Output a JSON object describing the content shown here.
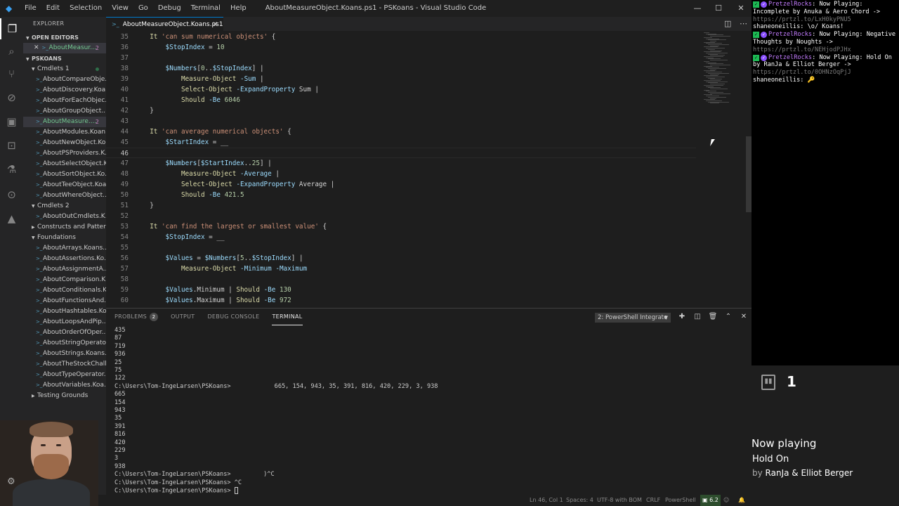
{
  "window": {
    "title": "AboutMeasureObject.Koans.ps1 - PSKoans - Visual Studio Code",
    "menu": [
      "File",
      "Edit",
      "Selection",
      "View",
      "Go",
      "Debug",
      "Terminal",
      "Help"
    ]
  },
  "sidebar": {
    "title": "EXPLORER",
    "open_editors": "OPEN EDITORS",
    "open_file": "AboutMeasur...",
    "open_file_badge": "2",
    "project": "PSKOANS",
    "folders": {
      "cmdlets1": "Cmdlets 1",
      "cmdlets2": "Cmdlets 2",
      "constructs": "Constructs and Patter...",
      "foundations": "Foundations",
      "testing": "Testing Grounds"
    },
    "cmdlets1_files": [
      "AboutCompareObje...",
      "AboutDiscovery.Koa...",
      "AboutForEachObjec...",
      "AboutGroupObject....",
      "AboutMeasure....",
      "AboutModules.Koan...",
      "AboutNewObject.Ko...",
      "AboutPSProviders.K...",
      "AboutSelectObject.K...",
      "AboutSortObject.Ko...",
      "AboutTeeObject.Koa...",
      "AboutWhereObject...."
    ],
    "selected_badge": "2",
    "cmdlets2_files": [
      "AboutOutCmdlets.K..."
    ],
    "foundations_files": [
      "AboutArrays.Koans....",
      "AboutAssertions.Ko...",
      "AboutAssignmentA...",
      "AboutComparison.K...",
      "AboutConditionals.K...",
      "AboutFunctionsAnd...",
      "AboutHashtables.Ko...",
      "AboutLoopsAndPip...",
      "AboutOrderOfOper...",
      "AboutStringOperato...",
      "AboutStrings.Koans....",
      "AboutTheStockChall...",
      "AboutTypeOperator....",
      "AboutVariables.Koa..."
    ]
  },
  "tab": {
    "label": "AboutMeasureObject.Koans.ps1"
  },
  "editor": {
    "lines": [
      {
        "n": "35",
        "t": "  It 'can sum numerical objects' {"
      },
      {
        "n": "36",
        "t": "      $StopIndex = 10"
      },
      {
        "n": "37",
        "t": ""
      },
      {
        "n": "38",
        "t": "      $Numbers[0..$StopIndex] |"
      },
      {
        "n": "39",
        "t": "          Measure-Object -Sum |"
      },
      {
        "n": "40",
        "t": "          Select-Object -ExpandProperty Sum |"
      },
      {
        "n": "41",
        "t": "          Should -Be 6046"
      },
      {
        "n": "42",
        "t": "  }"
      },
      {
        "n": "43",
        "t": ""
      },
      {
        "n": "44",
        "t": "  It 'can average numerical objects' {"
      },
      {
        "n": "45",
        "t": "      $StartIndex = __"
      },
      {
        "n": "46",
        "t": ""
      },
      {
        "n": "47",
        "t": "      $Numbers[$StartIndex..25] |"
      },
      {
        "n": "48",
        "t": "          Measure-Object -Average |"
      },
      {
        "n": "49",
        "t": "          Select-Object -ExpandProperty Average |"
      },
      {
        "n": "50",
        "t": "          Should -Be 421.5"
      },
      {
        "n": "51",
        "t": "  }"
      },
      {
        "n": "52",
        "t": ""
      },
      {
        "n": "53",
        "t": "  It 'can find the largest or smallest value' {"
      },
      {
        "n": "54",
        "t": "      $StopIndex = __"
      },
      {
        "n": "55",
        "t": ""
      },
      {
        "n": "56",
        "t": "      $Values = $Numbers[5..$StopIndex] |"
      },
      {
        "n": "57",
        "t": "          Measure-Object -Minimum -Maximum"
      },
      {
        "n": "58",
        "t": ""
      },
      {
        "n": "59",
        "t": "      $Values.Minimum | Should -Be 130"
      },
      {
        "n": "60",
        "t": "      $Values.Maximum | Should -Be 972"
      }
    ]
  },
  "panel": {
    "tabs": {
      "problems": "PROBLEMS",
      "output": "OUTPUT",
      "debug": "DEBUG CONSOLE",
      "terminal": "TERMINAL"
    },
    "problems_count": "2",
    "terminal_select": "2: PowerShell Integrate",
    "terminal_lines": [
      "435",
      "87",
      "719",
      "936",
      "25",
      "75",
      "122",
      "C:\\Users\\Tom-IngeLarsen\\PSKoans>            665, 154, 943, 35, 391, 816, 420, 229, 3, 938",
      "665",
      "154",
      "943",
      "35",
      "391",
      "816",
      "420",
      "229",
      "3",
      "938",
      "C:\\Users\\Tom-IngeLarsen\\PSKoans>         )^C",
      "C:\\Users\\Tom-IngeLarsen\\PSKoans> ^C",
      "C:\\Users\\Tom-IngeLarsen\\PSKoans> "
    ]
  },
  "statusbar": {
    "position": "Ln 46, Col 1",
    "spaces": "Spaces: 4",
    "encoding": "UTF-8 with BOM",
    "eol": "CRLF",
    "language": "PowerShell",
    "version": "6.2"
  },
  "chat": {
    "messages": [
      {
        "user": "PretzelRocks",
        "text": ": Now Playing: Incomplete by Anuka & Aero Chord ->",
        "link": "https://prtzl.to/LxH0kyPNU5",
        "bot": true
      },
      {
        "user": "shaneoneillis",
        "text": ": \\o/ Koans!",
        "bot": false
      },
      {
        "user": "PretzelRocks",
        "text": ": Now Playing: Negative Thoughts by Noughts ->",
        "link": "https://prtzl.to/NEHjodPJHx",
        "bot": true
      },
      {
        "user": "PretzelRocks",
        "text": ": Now Playing: Hold On by RanJa & Elliot Berger ->",
        "link": "https://prtzl.to/0OHNzOqPjJ",
        "bot": true
      },
      {
        "user": "shaneoneillis",
        "text": ": 🔑",
        "bot": false
      }
    ]
  },
  "twitch": {
    "viewers": "1"
  },
  "nowplaying": {
    "title": "Now playing",
    "song": "Hold On",
    "by": "by",
    "artist": "RanJa & Elliot Berger"
  },
  "colors": {
    "accent": "#007acc",
    "chat_user": "#c37cff",
    "bot_badge": "#1db954"
  }
}
